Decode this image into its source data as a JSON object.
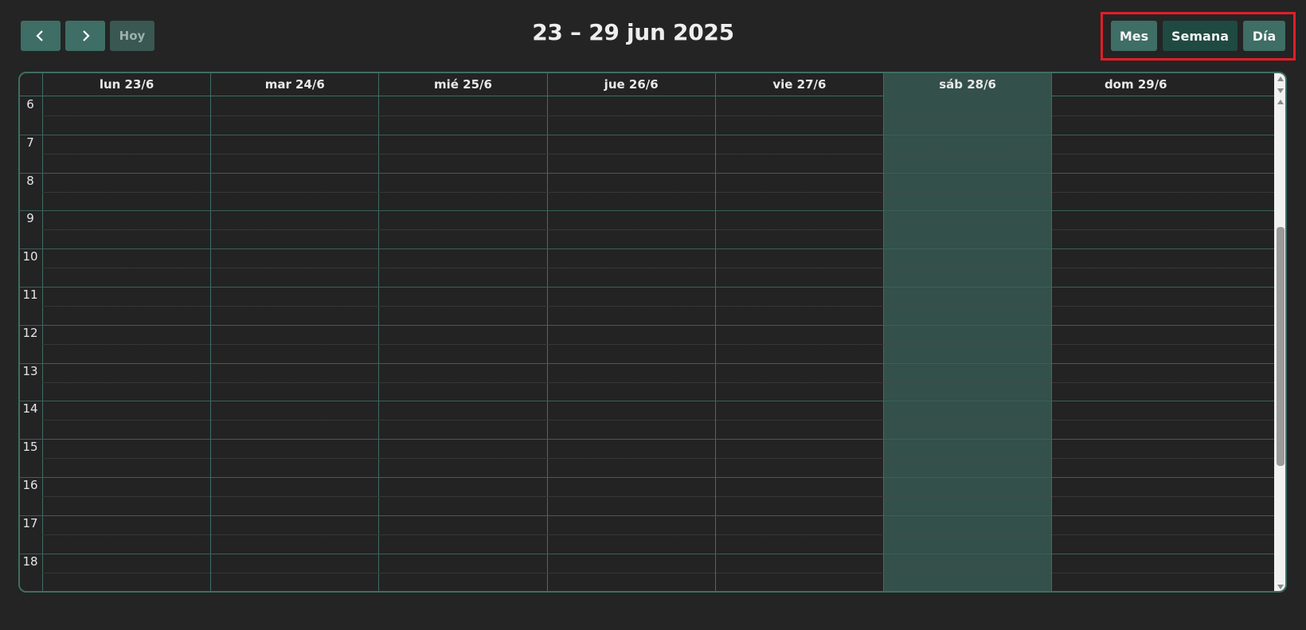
{
  "toolbar": {
    "prev_icon": "chevron-left-icon",
    "next_icon": "chevron-right-icon",
    "today_label": "Hoy",
    "title": "23 – 29 jun 2025",
    "views": [
      "Mes",
      "Semana",
      "Día"
    ],
    "active_view": "Semana"
  },
  "calendar": {
    "days": [
      "lun 23/6",
      "mar 24/6",
      "mié 25/6",
      "jue 26/6",
      "vie 27/6",
      "sáb 28/6",
      "dom 29/6"
    ],
    "highlighted_day": "sáb 28/6",
    "hours": [
      "6",
      "7",
      "8",
      "9",
      "10",
      "11",
      "12",
      "13",
      "14",
      "15",
      "16",
      "17",
      "18"
    ]
  },
  "colors": {
    "accent": "#3e6e65",
    "active": "#1f4a41",
    "highlight_column": "#33504a",
    "background": "#242424",
    "focus_border": "#e01f28"
  }
}
